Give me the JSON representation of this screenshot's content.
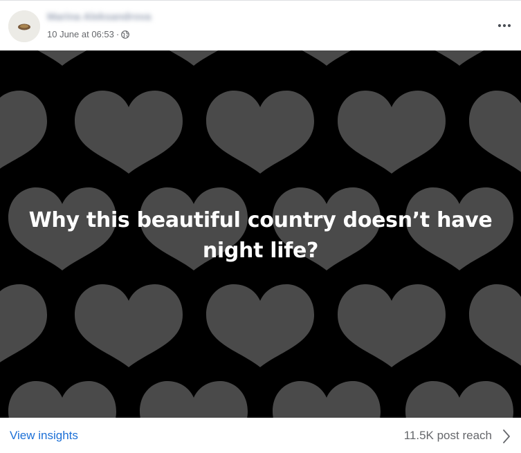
{
  "post": {
    "author_name": "Marina Aleksandrova",
    "date": "10 June at 06:53",
    "separator": "·",
    "privacy_icon": "globe-icon",
    "more_icon": "more-horizontal-icon",
    "text": "Why this beautiful country doesn’t have night life?",
    "background": {
      "color": "#000000",
      "pattern": "hearts",
      "heart_color": "#4a4a4a"
    }
  },
  "footer": {
    "view_insights_label": "View insights",
    "post_reach": "11.5K post reach",
    "chevron_icon": "chevron-right-icon"
  },
  "colors": {
    "link": "#1b6fd6",
    "secondary_text": "#65676b"
  }
}
